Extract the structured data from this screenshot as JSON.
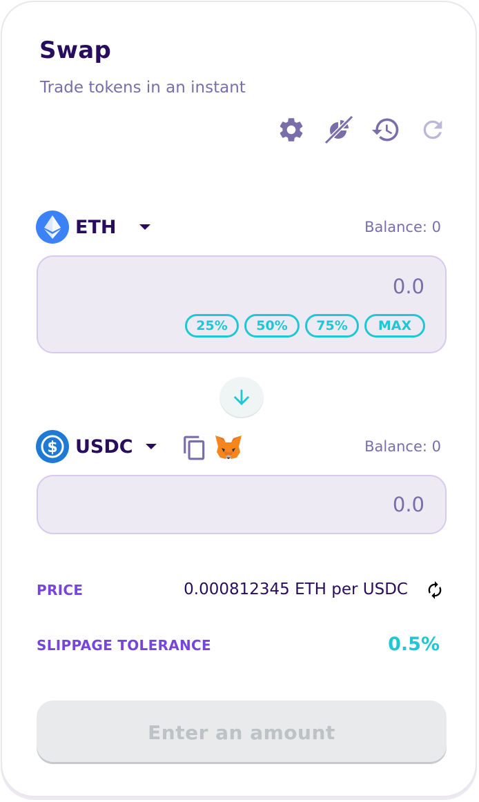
{
  "header": {
    "title": "Swap",
    "subtitle": "Trade tokens in an instant"
  },
  "toolbar": {
    "icons": [
      "gear-icon",
      "chart-off-icon",
      "history-icon",
      "refresh-icon"
    ]
  },
  "from": {
    "symbol": "ETH",
    "balance_label": "Balance: 0",
    "amount": "0.0",
    "percent_buttons": [
      "25%",
      "50%",
      "75%",
      "MAX"
    ],
    "logo_color": "#3b82f6"
  },
  "to": {
    "symbol": "USDC",
    "balance_label": "Balance: 0",
    "amount": "0.0",
    "logo_color": "#1f7ad6"
  },
  "info": {
    "price_label": "PRICE",
    "price_value": "0.000812345 ETH per USDC",
    "slippage_label": "SLIPPAGE TOLERANCE",
    "slippage_value": "0.5%"
  },
  "cta": {
    "label": "Enter an amount"
  },
  "colors": {
    "primary_text": "#280d5f",
    "secondary_text": "#7a6eaa",
    "accent": "#1fc7d4",
    "label_purple": "#7645d9",
    "input_bg": "#eeeaf4"
  }
}
